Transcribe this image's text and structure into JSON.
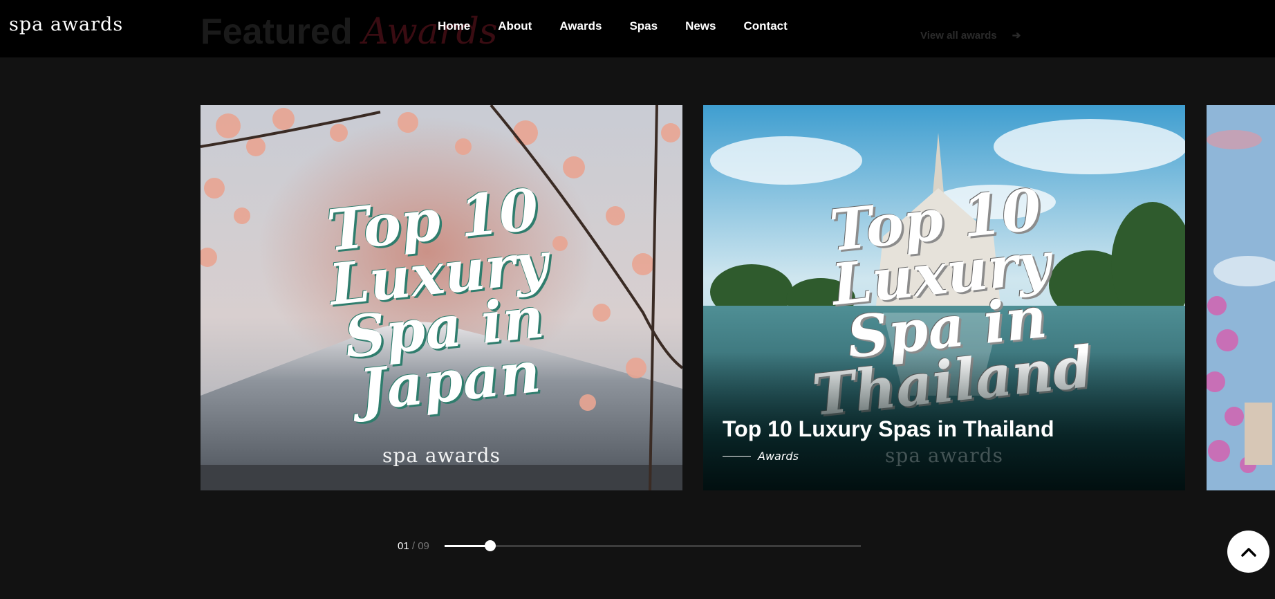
{
  "header": {
    "logo": "spa awards",
    "section_title": "Featured",
    "section_title_accent": "Awards",
    "view_all": "View all awards",
    "view_all_arrow": "➔",
    "nav": [
      {
        "label": "Home"
      },
      {
        "label": "About"
      },
      {
        "label": "Awards"
      },
      {
        "label": "Spas"
      },
      {
        "label": "News"
      },
      {
        "label": "Contact"
      }
    ]
  },
  "cards": [
    {
      "poster_lines": [
        "Top 10",
        "Luxury",
        "Spa in",
        "Japan"
      ],
      "poster_brand": "spa awards"
    },
    {
      "poster_lines": [
        "Top 10",
        "Luxury",
        "Spa in",
        "Thailand"
      ],
      "poster_brand": "spa awards",
      "caption": "Top 10 Luxury Spas in Thailand",
      "category": "Awards"
    }
  ],
  "slider": {
    "current": "01",
    "separator": "/",
    "total": "09",
    "progress_fraction": 0.11
  },
  "icons": {
    "back_to_top": "chevron-up-icon",
    "view_all": "arrow-right-icon"
  },
  "colors": {
    "background": "#121212",
    "header": "#000000",
    "accent": "#3a0c12"
  }
}
